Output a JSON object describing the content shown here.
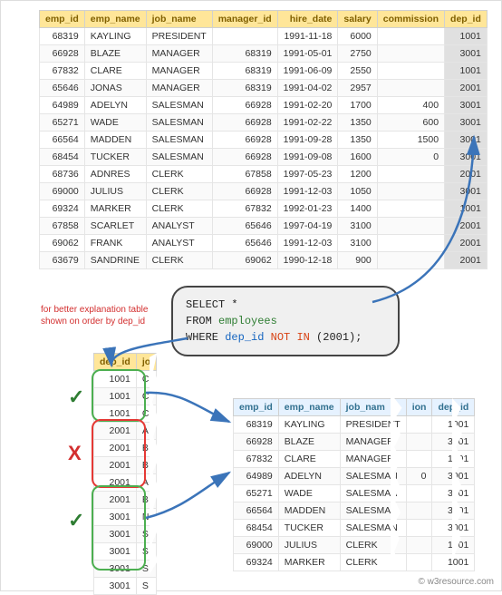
{
  "attribution": "© w3resource.com",
  "note_text": "for better explanation table shown on order by dep_id",
  "sql": {
    "line1_a": "SELECT *",
    "line2_a": "FROM ",
    "line2_b": "employees",
    "line3_a": "WHERE ",
    "line3_b": "dep_id",
    "line3_c": " NOT IN ",
    "line3_d": "(2001);"
  },
  "main_table": {
    "headers": [
      "emp_id",
      "emp_name",
      "job_name",
      "manager_id",
      "hire_date",
      "salary",
      "commission",
      "dep_id"
    ],
    "rows": [
      [
        "68319",
        "KAYLING",
        "PRESIDENT",
        "",
        "1991-11-18",
        "6000",
        "",
        "1001"
      ],
      [
        "66928",
        "BLAZE",
        "MANAGER",
        "68319",
        "1991-05-01",
        "2750",
        "",
        "3001"
      ],
      [
        "67832",
        "CLARE",
        "MANAGER",
        "68319",
        "1991-06-09",
        "2550",
        "",
        "1001"
      ],
      [
        "65646",
        "JONAS",
        "MANAGER",
        "68319",
        "1991-04-02",
        "2957",
        "",
        "2001"
      ],
      [
        "64989",
        "ADELYN",
        "SALESMAN",
        "66928",
        "1991-02-20",
        "1700",
        "400",
        "3001"
      ],
      [
        "65271",
        "WADE",
        "SALESMAN",
        "66928",
        "1991-02-22",
        "1350",
        "600",
        "3001"
      ],
      [
        "66564",
        "MADDEN",
        "SALESMAN",
        "66928",
        "1991-09-28",
        "1350",
        "1500",
        "3001"
      ],
      [
        "68454",
        "TUCKER",
        "SALESMAN",
        "66928",
        "1991-09-08",
        "1600",
        "0",
        "3001"
      ],
      [
        "68736",
        "ADNRES",
        "CLERK",
        "67858",
        "1997-05-23",
        "1200",
        "",
        "2001"
      ],
      [
        "69000",
        "JULIUS",
        "CLERK",
        "66928",
        "1991-12-03",
        "1050",
        "",
        "3001"
      ],
      [
        "69324",
        "MARKER",
        "CLERK",
        "67832",
        "1992-01-23",
        "1400",
        "",
        "1001"
      ],
      [
        "67858",
        "SCARLET",
        "ANALYST",
        "65646",
        "1997-04-19",
        "3100",
        "",
        "2001"
      ],
      [
        "69062",
        "FRANK",
        "ANALYST",
        "65646",
        "1991-12-03",
        "3100",
        "",
        "2001"
      ],
      [
        "63679",
        "SANDRINE",
        "CLERK",
        "69062",
        "1990-12-18",
        "900",
        "",
        "2001"
      ]
    ]
  },
  "dep_table": {
    "headers": [
      "dep_id",
      "jo"
    ],
    "rows": [
      [
        "1001",
        "C"
      ],
      [
        "1001",
        "C"
      ],
      [
        "1001",
        "C"
      ],
      [
        "2001",
        "A"
      ],
      [
        "2001",
        "B"
      ],
      [
        "2001",
        "B"
      ],
      [
        "2001",
        "A"
      ],
      [
        "2001",
        "B"
      ],
      [
        "3001",
        "N"
      ],
      [
        "3001",
        "S"
      ],
      [
        "3001",
        "S"
      ],
      [
        "3001",
        "S"
      ],
      [
        "3001",
        "S"
      ]
    ]
  },
  "result_table": {
    "headers": [
      "emp_id",
      "emp_name",
      "job_nam",
      "ion",
      "dep_id"
    ],
    "rows": [
      [
        "68319",
        "KAYLING",
        "PRESIDENT",
        "",
        "1001"
      ],
      [
        "66928",
        "BLAZE",
        "MANAGER",
        "",
        "3001"
      ],
      [
        "67832",
        "CLARE",
        "MANAGER",
        "",
        "1001"
      ],
      [
        "64989",
        "ADELYN",
        "SALESMAN",
        "0",
        "3001"
      ],
      [
        "65271",
        "WADE",
        "SALESMAN",
        "",
        "3001"
      ],
      [
        "66564",
        "MADDEN",
        "SALESMAN",
        "",
        "3001"
      ],
      [
        "68454",
        "TUCKER",
        "SALESMAN",
        "",
        "3001"
      ],
      [
        "69000",
        "JULIUS",
        "CLERK",
        "",
        "1001"
      ],
      [
        "69324",
        "MARKER",
        "CLERK",
        "",
        "1001"
      ]
    ]
  }
}
